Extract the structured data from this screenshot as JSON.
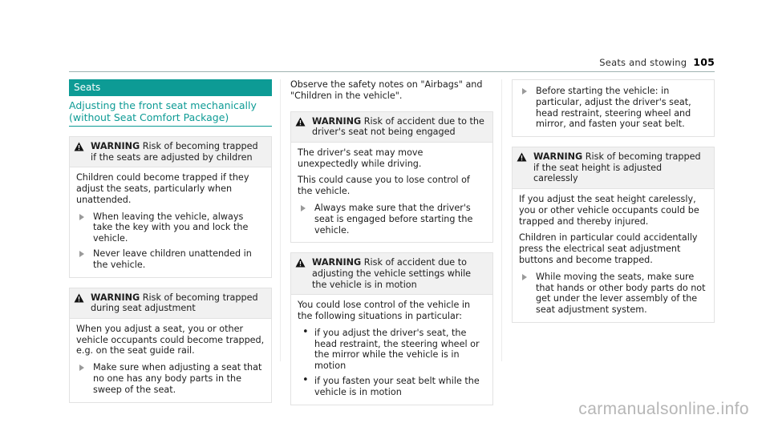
{
  "header": {
    "title": "Seats and stowing",
    "page_number": "105",
    "accent_color": "#0d9b95"
  },
  "watermark": {
    "text": "carmanualsonline.info"
  },
  "icons": {
    "warning": "warning-triangle-icon"
  },
  "column1": {
    "section_chip": "Seats",
    "subheading": "Adjusting the front seat mechanically (without Seat Comfort Package)",
    "warnings": [
      {
        "label": "WARNING",
        "title": "Risk of becoming trapped if the seats are adjusted by children",
        "paragraphs": [
          "Children could become trapped if they adjust the seats, particularly when unattended."
        ],
        "items": [
          "When leaving the vehicle, always take the key with you and lock the vehicle.",
          "Never leave children unattended in the vehicle."
        ],
        "marker": "arrow"
      },
      {
        "label": "WARNING",
        "title": "Risk of becoming trapped during seat adjustment",
        "paragraphs": [
          "When you adjust a seat, you or other vehicle occupants could become trapped, e.g. on the seat guide rail."
        ],
        "items": [
          "Make sure when adjusting a seat that no one has any body parts in the sweep of the seat."
        ],
        "marker": "arrow"
      }
    ]
  },
  "column2": {
    "intro": "Observe the safety notes on \"Airbags\" and \"Children in the vehicle\".",
    "warnings": [
      {
        "label": "WARNING",
        "title": "Risk of accident due to the driver's seat not being engaged",
        "paragraphs": [
          "The driver's seat may move unexpectedly while driving.",
          "This could cause you to lose control of the vehicle."
        ],
        "items": [
          "Always make sure that the driver's seat is engaged before starting the vehicle."
        ],
        "marker": "arrow"
      },
      {
        "label": "WARNING",
        "title": "Risk of accident due to adjusting the vehicle settings while the vehicle is in motion",
        "paragraphs": [
          "You could lose control of the vehicle in the following situations in particular:"
        ],
        "items": [
          "if you adjust the driver's seat, the head restraint, the steering wheel or the mirror while the vehicle is in motion",
          "if you fasten your seat belt while the vehicle is in motion"
        ],
        "marker": "dot"
      }
    ]
  },
  "column3": {
    "top_items": [
      "Before starting the vehicle: in particular, adjust the driver's seat, head restraint, steering wheel and mirror, and fasten your seat belt."
    ],
    "top_marker": "arrow",
    "warnings": [
      {
        "label": "WARNING",
        "title": "Risk of becoming trapped if the seat height is adjusted carelessly",
        "paragraphs": [
          "If you adjust the seat height carelessly, you or other vehicle occupants could be trapped and thereby injured.",
          "Children in particular could accidentally press the electrical seat adjustment buttons and become trapped."
        ],
        "items": [
          "While moving the seats, make sure that hands or other body parts do not get under the lever assembly of the seat adjustment system."
        ],
        "marker": "arrow"
      }
    ]
  }
}
